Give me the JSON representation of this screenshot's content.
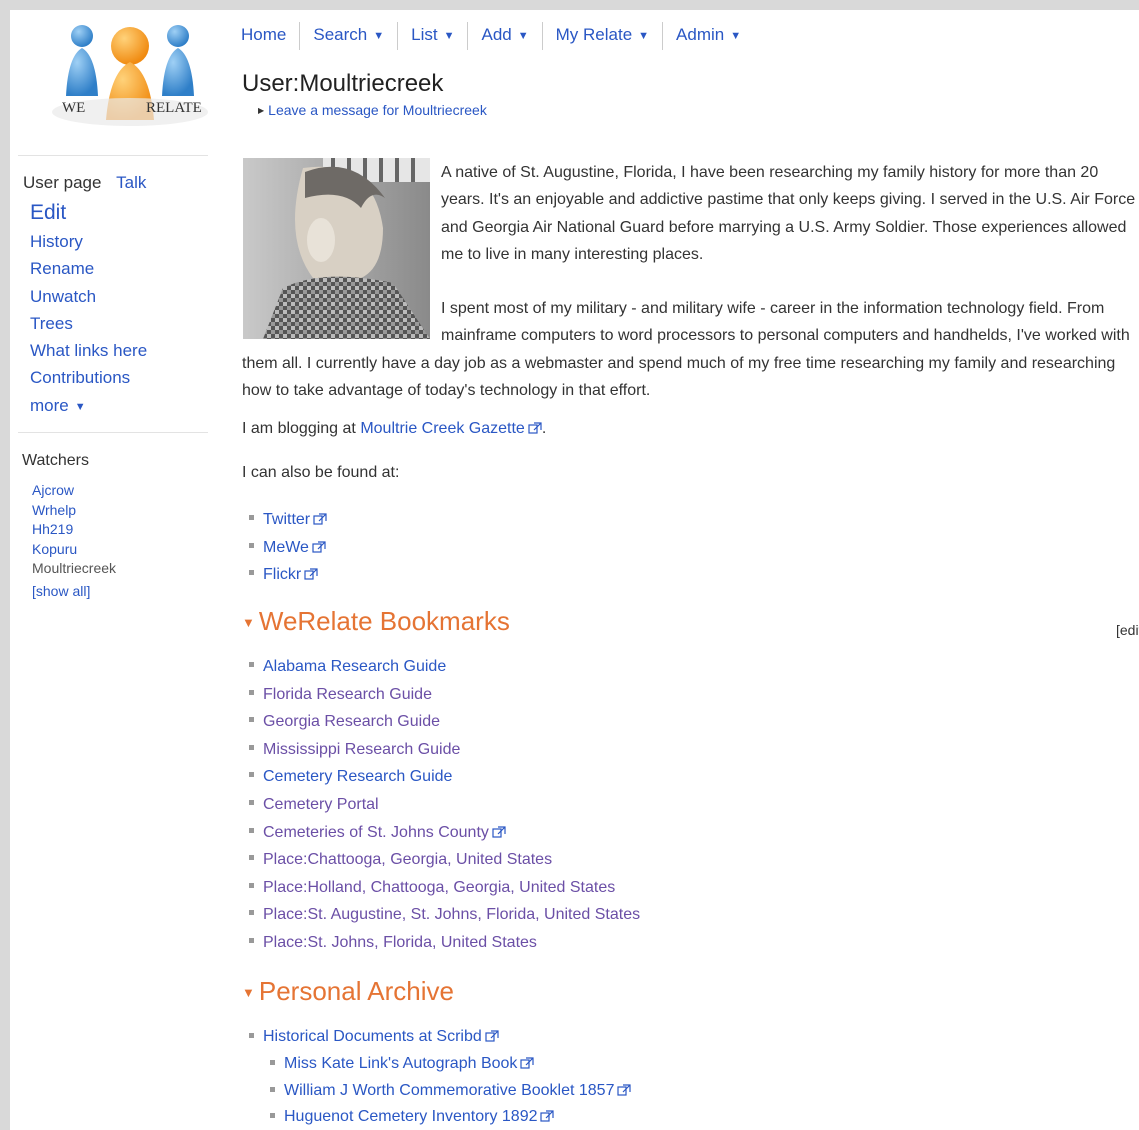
{
  "logo": {
    "word_left": "WE",
    "word_right": "RELATE"
  },
  "sidebar": {
    "tab_user": "User page",
    "tab_talk": "Talk",
    "actions": [
      "Edit",
      "History",
      "Rename",
      "Unwatch",
      "Trees",
      "What links here",
      "Contributions",
      "more"
    ],
    "watchers_title": "Watchers",
    "watchers": [
      "Ajcrow",
      "Wrhelp",
      "Hh219",
      "Kopuru",
      "Moultriecreek"
    ],
    "show_all": "[show all]"
  },
  "nav": [
    "Home",
    "Search",
    "List",
    "Add",
    "My Relate",
    "Admin"
  ],
  "page": {
    "title": "User:Moultriecreek",
    "leave_message": "Leave a message for Moultriecreek",
    "bio1": "A native of St. Augustine, Florida, I have been researching my family history for more than 20 years. It's an enjoyable and addictive pastime that only keeps giving. I served in the U.S. Air Force and Georgia Air National Guard before marrying a U.S. Army Soldier. Those experiences allowed me to live in many interesting places.",
    "bio2": "I spent most of my military - and military wife - career in the information technology field. From mainframe computers to word processors to personal computers and handhelds, I've worked with them all. I currently have a day job as a webmaster and spend much of my free time researching my family and researching how to take advantage of today's technology in that effort.",
    "blog_prefix": "I am blogging at",
    "blog_link": "Moultrie Creek Gazette",
    "blog_suffix": ".",
    "found_at": "I can also be found at:",
    "social": [
      "Twitter",
      "MeWe",
      "Flickr"
    ]
  },
  "bookmarks": {
    "heading": "WeRelate Bookmarks",
    "edit": "[edit]",
    "items": [
      {
        "label": "Alabama Research Guide",
        "visited": false,
        "external": false
      },
      {
        "label": "Florida Research Guide",
        "visited": true,
        "external": false
      },
      {
        "label": "Georgia Research Guide",
        "visited": true,
        "external": false
      },
      {
        "label": "Mississippi Research Guide",
        "visited": true,
        "external": false
      },
      {
        "label": "Cemetery Research Guide",
        "visited": false,
        "external": false
      },
      {
        "label": "Cemetery Portal",
        "visited": true,
        "external": false
      },
      {
        "label": "Cemeteries of St. Johns County",
        "visited": true,
        "external": true
      },
      {
        "label": "Place:Chattooga, Georgia, United States",
        "visited": true,
        "external": false
      },
      {
        "label": "Place:Holland, Chattooga, Georgia, United States",
        "visited": true,
        "external": false
      },
      {
        "label": "Place:St. Augustine, St. Johns, Florida, United States",
        "visited": true,
        "external": false
      },
      {
        "label": "Place:St. Johns, Florida, United States",
        "visited": true,
        "external": false
      }
    ]
  },
  "archive": {
    "heading": "Personal Archive",
    "items": [
      {
        "label": "Historical Documents at Scribd",
        "sub": false
      },
      {
        "label": "Miss Kate Link's Autograph Book",
        "sub": true
      },
      {
        "label": "William J Worth Commemorative Booklet 1857",
        "sub": true
      },
      {
        "label": "Huguenot Cemetery Inventory 1892",
        "sub": true
      }
    ]
  },
  "colors": {
    "link": "#2a57c4",
    "visited": "#6b4fa6",
    "heading": "#e57434",
    "background": "#d9d9d9"
  }
}
